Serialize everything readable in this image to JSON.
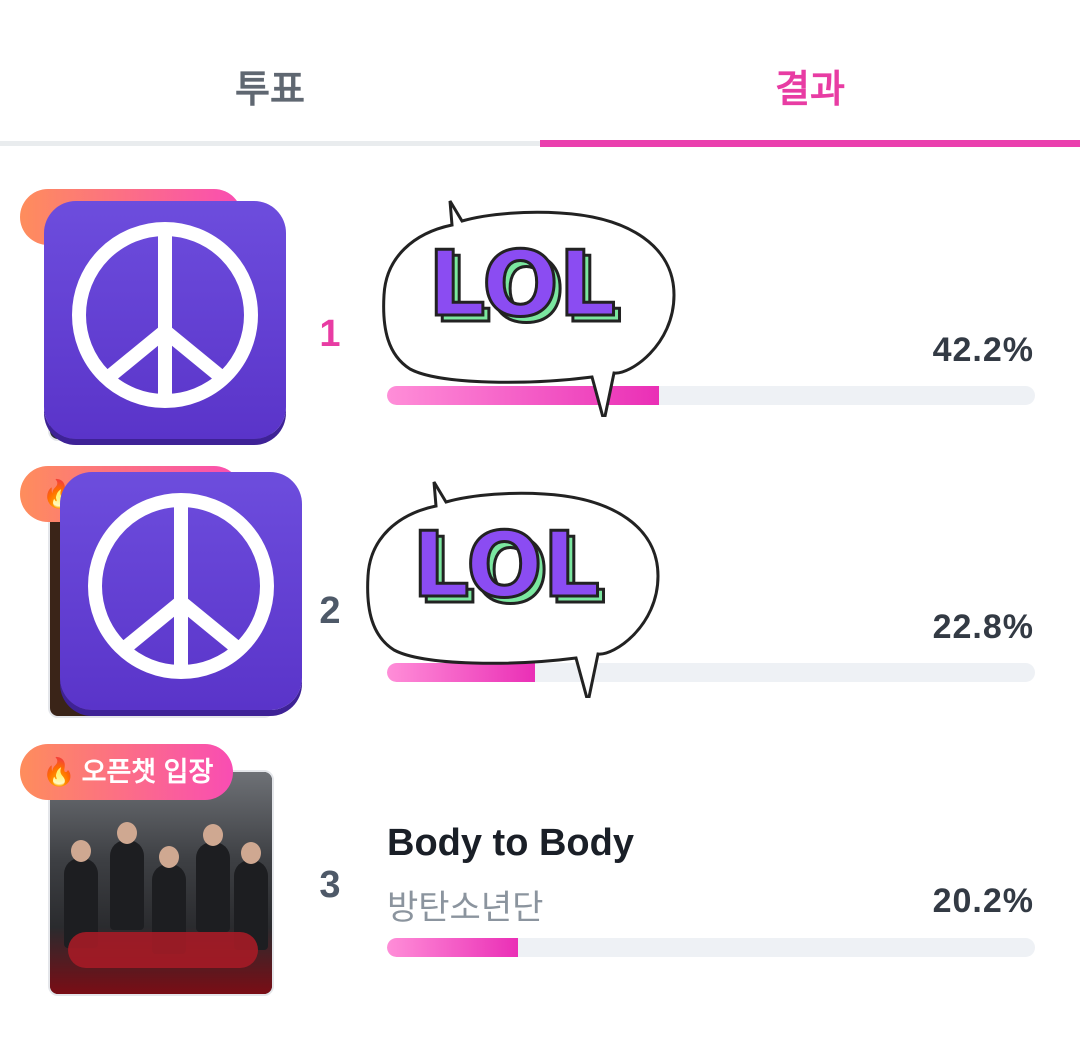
{
  "tabs": {
    "vote": "투표",
    "result": "결과"
  },
  "colors": {
    "accent": "#ea3fae",
    "bar_track": "#eef1f5",
    "badge_start": "#fe8d5c",
    "badge_end": "#f94db3"
  },
  "rows": [
    {
      "rank": "1",
      "title": "",
      "artist": "",
      "percent": "42.2%",
      "share": 0.422,
      "badge": "",
      "bar_fraction": 0.42
    },
    {
      "rank": "2",
      "title": "",
      "artist": "",
      "percent": "22.8%",
      "share": 0.228,
      "badge": "",
      "bar_fraction": 0.228
    },
    {
      "rank": "3",
      "title": "Body to Body",
      "artist": "방탄소년단",
      "percent": "20.2%",
      "share": 0.202,
      "badge": "오픈챗 입장",
      "bar_fraction": 0.202
    }
  ],
  "stickers": {
    "speech": "LOL",
    "icon": "peace-sign-icon"
  }
}
